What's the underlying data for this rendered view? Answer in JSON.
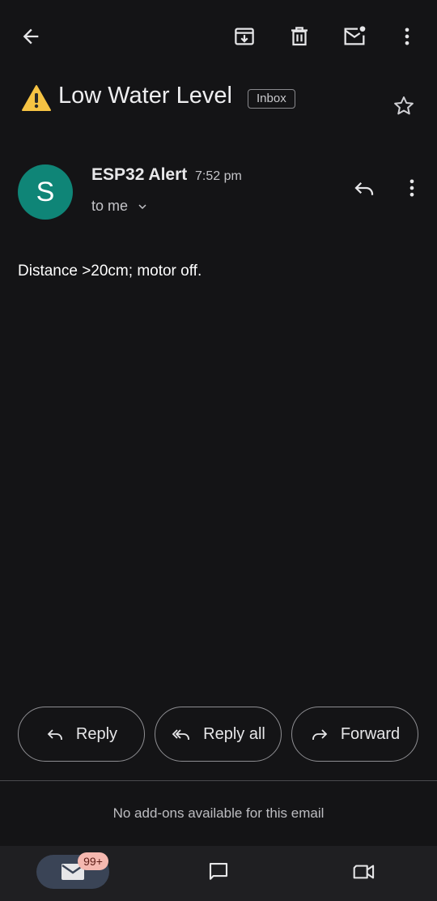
{
  "toolbar": {
    "back_icon": "arrow-left-icon",
    "archive_icon": "archive-icon",
    "delete_icon": "trash-icon",
    "mark_unread_icon": "mark-unread-icon",
    "more_icon": "more-vert-icon"
  },
  "email": {
    "subject": "Low Water Level",
    "subject_emoji": "warning-icon",
    "label": "Inbox",
    "starred": false,
    "sender_initial": "S",
    "sender_name": "ESP32 Alert",
    "time": "7:52 pm",
    "recipient": "to me",
    "body": "Distance >20cm; motor off."
  },
  "actions": {
    "reply": "Reply",
    "reply_all": "Reply all",
    "forward": "Forward"
  },
  "addons_text": "No add-ons available for this email",
  "bottom_nav": {
    "mail_badge": "99+",
    "items": [
      "mail-icon",
      "chat-icon",
      "meet-icon"
    ]
  },
  "colors": {
    "background": "#141416",
    "avatar": "#0f8577",
    "badge": "#f5b8b0",
    "nav_active": "#3a4456"
  }
}
